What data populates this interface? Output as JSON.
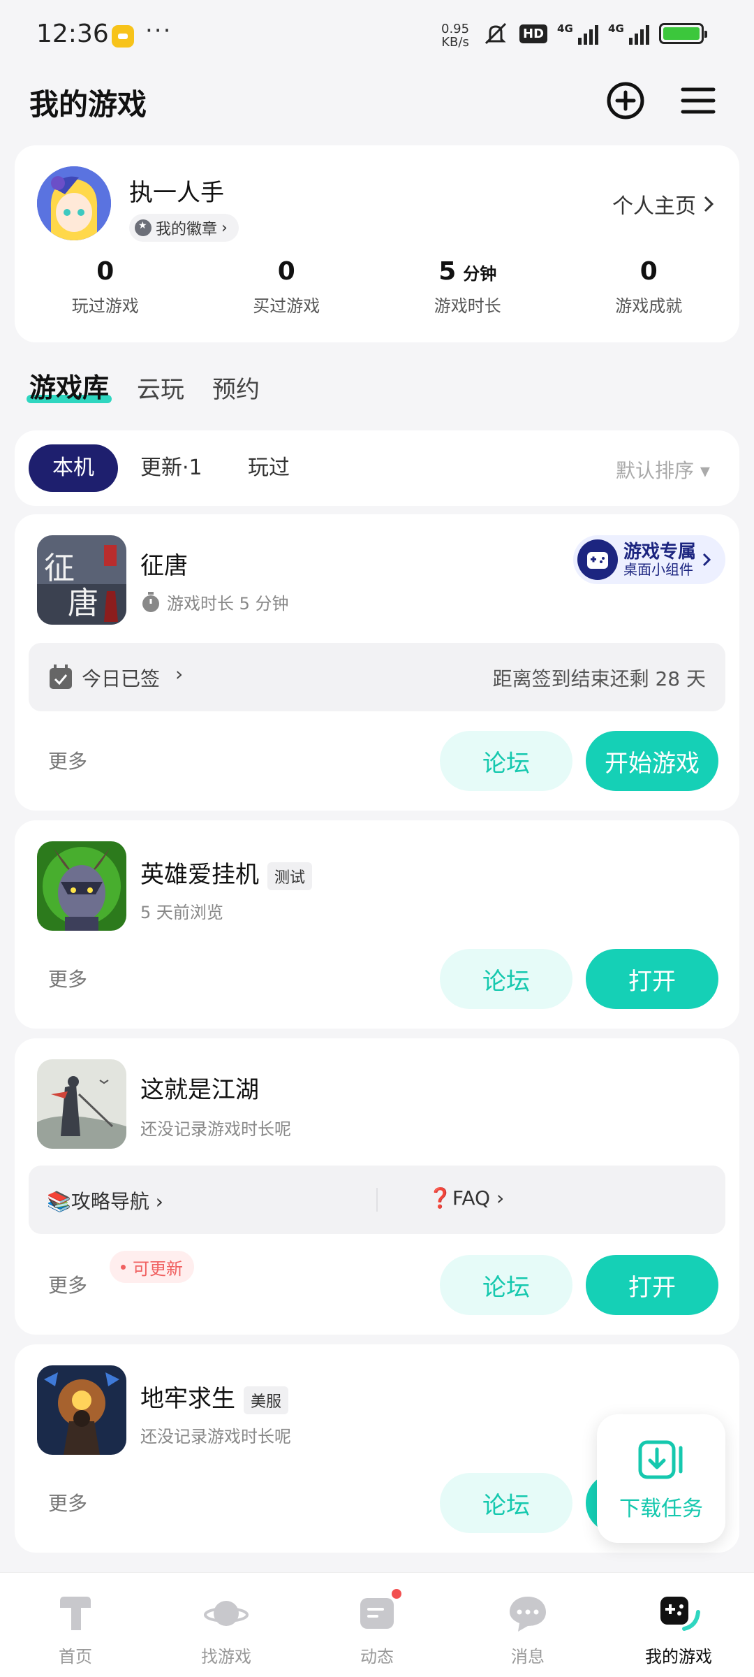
{
  "status_bar": {
    "time": "12:36",
    "dots": "···",
    "speed_value": "0.95",
    "speed_unit": "KB/s",
    "hd": "HD",
    "network1": "4G",
    "network2": "4G"
  },
  "header": {
    "title": "我的游戏"
  },
  "profile": {
    "username": "执一人手",
    "badge_label": "我的徽章",
    "homepage_label": "个人主页",
    "stats": [
      {
        "value": "0",
        "unit": "",
        "label": "玩过游戏"
      },
      {
        "value": "0",
        "unit": "",
        "label": "买过游戏"
      },
      {
        "value": "5",
        "unit": "分钟",
        "label": "游戏时长"
      },
      {
        "value": "0",
        "unit": "",
        "label": "游戏成就"
      }
    ]
  },
  "main_tabs": [
    "游戏库",
    "云玩",
    "预约"
  ],
  "filter": {
    "chips": [
      "本机",
      "更新·1",
      "玩过"
    ],
    "sort": "默认排序 ▾"
  },
  "games": [
    {
      "name": "征唐",
      "subtitle": "游戏时长 5 分钟",
      "widget_title": "游戏专属",
      "widget_sub": "桌面小组件",
      "checkin": "今日已签",
      "checkin_remaining": "距离签到结束还剩 28 天",
      "more": "更多",
      "forum": "论坛",
      "action": "开始游戏"
    },
    {
      "name": "英雄爱挂机",
      "tag": "测试",
      "subtitle": "5 天前浏览",
      "more": "更多",
      "forum": "论坛",
      "action": "打开"
    },
    {
      "name": "这就是江湖",
      "subtitle": "还没记录游戏时长呢",
      "guide": "📚攻略导航",
      "faq": "❓FAQ",
      "more": "更多",
      "update": "可更新",
      "forum": "论坛",
      "action": "打开"
    },
    {
      "name": "地牢求生",
      "tag": "美服",
      "subtitle": "还没记录游戏时长呢",
      "more": "更多",
      "forum": "论坛"
    }
  ],
  "download_fab": {
    "label": "下载任务"
  },
  "bottom_nav": [
    {
      "label": "首页"
    },
    {
      "label": "找游戏"
    },
    {
      "label": "动态"
    },
    {
      "label": "消息"
    },
    {
      "label": "我的游戏"
    }
  ],
  "colors": {
    "accent": "#15d0b6",
    "chip_active": "#1e1f6e",
    "badge_red": "#f06060"
  }
}
